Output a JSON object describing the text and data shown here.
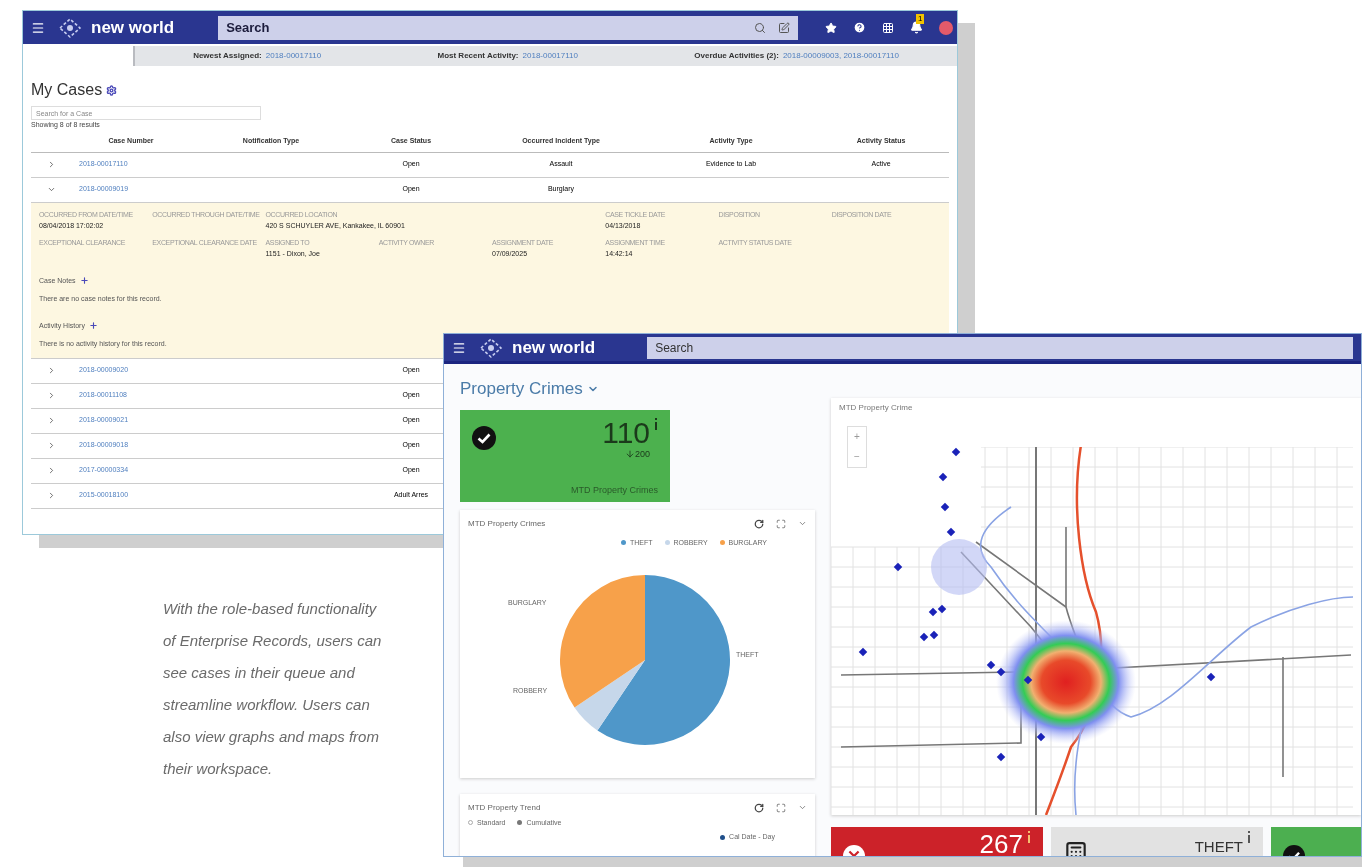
{
  "cases_window": {
    "logo": "new world",
    "search": {
      "value": "Search"
    },
    "notification_count": "1",
    "summary": [
      {
        "label": "Newest Assigned:",
        "value": "2018-00017110"
      },
      {
        "label": "Most Recent Activity:",
        "value": "2018-00017110"
      },
      {
        "label": "Overdue Activities (2):",
        "value": "2018-00009003, 2018-00017110"
      }
    ],
    "title": "My Cases",
    "case_search": {
      "placeholder": "Search for a Case"
    },
    "result_count": "Showing 8 of 8 results",
    "table": {
      "columns": [
        "Case Number",
        "Notification Type",
        "Case Status",
        "Occurred Incident Type",
        "Activity Type",
        "Activity Status"
      ],
      "rows": [
        {
          "expanded": false,
          "case_number": "2018-00017110",
          "case_status": "Open",
          "incident_type": "Assault",
          "activity_type": "Evidence to Lab",
          "activity_status": "Active"
        },
        {
          "expanded": true,
          "case_number": "2018-00009019",
          "case_status": "Open",
          "incident_type": "Burglary",
          "detail": {
            "fields": [
              [
                {
                  "label": "OCCURRED FROM DATE/TIME",
                  "value": "08/04/2018 17:02:02"
                },
                {
                  "label": "OCCURRED THROUGH DATE/TIME"
                },
                {
                  "label": "OCCURRED LOCATION",
                  "value": "420 S SCHUYLER AVE, Kankakee, IL 60901"
                },
                {
                  "label": "CASE TICKLE DATE",
                  "value": "04/13/2018"
                },
                {
                  "label": "DISPOSITION"
                },
                {
                  "label": "DISPOSITION DATE"
                }
              ],
              [
                {
                  "label": "EXCEPTIONAL CLEARANCE"
                },
                {
                  "label": "EXCEPTIONAL CLEARANCE DATE"
                },
                {
                  "label": "ASSIGNED TO",
                  "value": "1151 - Dixon, Joe"
                },
                {
                  "label": "ACTIVITY OWNER"
                },
                {
                  "label": "ASSIGNMENT DATE",
                  "value": "07/09/2025"
                },
                {
                  "label": "ASSIGNMENT TIME",
                  "value": "14:42:14"
                },
                {
                  "label": "ACTIVITY STATUS DATE"
                }
              ]
            ],
            "sections": [
              {
                "title": "Case Notes",
                "message": "There are no case notes for this record."
              },
              {
                "title": "Activity History",
                "message": "There is no activity history for this record."
              }
            ]
          }
        },
        {
          "expanded": false,
          "case_number": "2018-00009020",
          "case_status": "Open"
        },
        {
          "expanded": false,
          "case_number": "2018-00011108",
          "case_status": "Open"
        },
        {
          "expanded": false,
          "case_number": "2018-00009021",
          "case_status": "Open"
        },
        {
          "expanded": false,
          "case_number": "2018-00009018",
          "case_status": "Open"
        },
        {
          "expanded": false,
          "case_number": "2017-00000334",
          "case_status": "Open"
        },
        {
          "expanded": false,
          "case_number": "2015-00018100",
          "case_status": "Adult Arres"
        }
      ]
    }
  },
  "dashboard_window": {
    "logo": "new world",
    "search": {
      "value": "Search"
    },
    "title": "Property Crimes",
    "kpi": {
      "value": "110",
      "change": "200",
      "label": "MTD Property Crimes"
    },
    "pie_panel": {
      "title": "MTD Property Crimes",
      "legend": [
        {
          "name": "THEFT",
          "color": "#4f97c9"
        },
        {
          "name": "ROBBERY",
          "color": "#c6d7ea"
        },
        {
          "name": "BURGLARY",
          "color": "#f7a14a"
        }
      ],
      "slice_labels": [
        "BURGLARY",
        "ROBBERY",
        "THEFT"
      ]
    },
    "trend_panel": {
      "title": "MTD Property Trend",
      "modes": [
        {
          "label": "Standard",
          "selected": false
        },
        {
          "label": "Cumulative",
          "selected": true
        }
      ],
      "legend": "Cal Date - Day"
    },
    "map_panel": {
      "title": "MTD Property Crime",
      "zoom": [
        "+",
        "−"
      ]
    },
    "cards": [
      {
        "kind": "alert",
        "value": "267"
      },
      {
        "kind": "category",
        "value": "THEFT"
      },
      {
        "kind": "ok"
      }
    ]
  },
  "caption": "With the role-based functionality of Enterprise Records, users can see cases in their queue and streamline workflow. Users can also view graphs and maps from their workspace."
}
